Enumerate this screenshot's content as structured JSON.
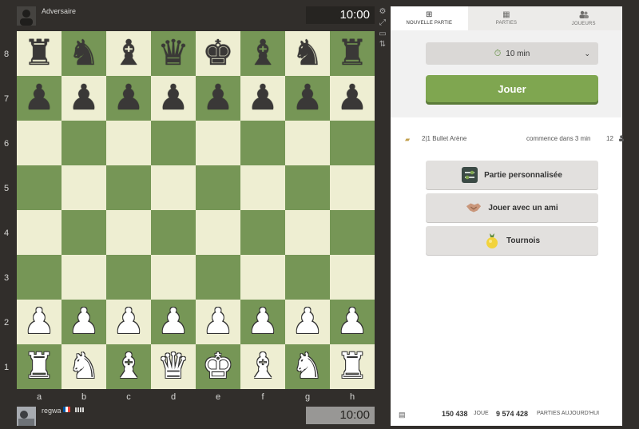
{
  "players": {
    "top": {
      "name": "Adversaire",
      "clock": "10:00"
    },
    "bottom": {
      "name": "regwa",
      "clock": "10:00",
      "flag_colors": [
        "#0055a4",
        "#ffffff",
        "#ef4135"
      ]
    }
  },
  "board": {
    "ranks": [
      "8",
      "7",
      "6",
      "5",
      "4",
      "3",
      "2",
      "1"
    ],
    "files": [
      "a",
      "b",
      "c",
      "d",
      "e",
      "f",
      "g",
      "h"
    ],
    "light_color": "#eeeed2",
    "dark_color": "#769656",
    "pieces": {
      "a8": "♜",
      "b8": "♞",
      "c8": "♝",
      "d8": "♛",
      "e8": "♚",
      "f8": "♝",
      "g8": "♞",
      "h8": "♜",
      "a7": "♟",
      "b7": "♟",
      "c7": "♟",
      "d7": "♟",
      "e7": "♟",
      "f7": "♟",
      "g7": "♟",
      "h7": "♟",
      "a2": "♟",
      "b2": "♟",
      "c2": "♟",
      "d2": "♟",
      "e2": "♟",
      "f2": "♟",
      "g2": "♟",
      "h2": "♟",
      "a1": "♜",
      "b1": "♞",
      "c1": "♝",
      "d1": "♛",
      "e1": "♚",
      "f1": "♝",
      "g1": "♞",
      "h1": "♜"
    }
  },
  "tools": [
    "gear-icon",
    "expand-icon",
    "board-icon",
    "flip-icon"
  ],
  "panel": {
    "tabs": [
      {
        "label": "NOUVELLE PARTIE",
        "icon": "plus-square-icon",
        "glyph": "⊞",
        "active": true
      },
      {
        "label": "PARTIES",
        "icon": "chessboard-icon",
        "glyph": "▦",
        "active": false
      },
      {
        "label": "JOUEURS",
        "icon": "players-icon",
        "glyph": "👥",
        "active": false
      }
    ],
    "time_select": {
      "value": "10 min",
      "icon": "stopwatch-icon"
    },
    "play_button": "Jouer",
    "arena": {
      "name": "2|1 Bullet Arène",
      "start": "commence dans 3 min",
      "count": "12"
    },
    "options": [
      {
        "label": "Partie personnalisée",
        "icon": "custom-settings-icon"
      },
      {
        "label": "Jouer avec un ami",
        "icon": "handshake-icon"
      },
      {
        "label": "Tournois",
        "icon": "trophy-icon"
      }
    ],
    "footer": {
      "playing_count": "150 438",
      "playing_label": "JOUE",
      "games_count": "9 574 428",
      "games_label": "PARTIES AUJOURD'HUI"
    }
  },
  "colors": {
    "accent": "#7fa650",
    "background": "#312e2b"
  }
}
